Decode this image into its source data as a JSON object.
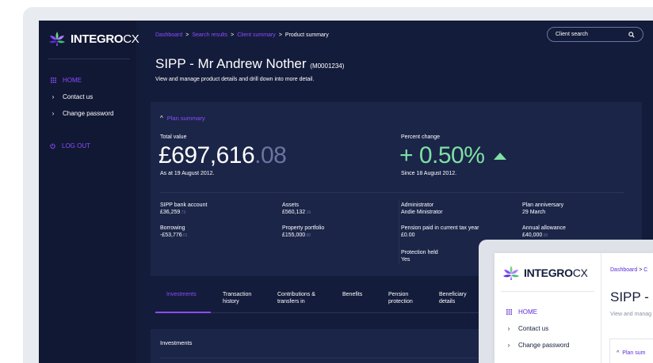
{
  "brand": {
    "name_bold": "INTEGRO",
    "name_light": "CX"
  },
  "sidebar": {
    "items": [
      {
        "label": "HOME",
        "icon": "grid-icon"
      },
      {
        "label": "Contact us",
        "icon": "chevron-right-icon"
      },
      {
        "label": "Change password",
        "icon": "chevron-right-icon"
      }
    ],
    "logout": {
      "label": "LOG OUT",
      "icon": "power-icon"
    }
  },
  "breadcrumb": {
    "items": [
      "Dashboard",
      "Search results",
      "Client summary"
    ],
    "current": "Product summary",
    "separator": ">"
  },
  "search": {
    "placeholder": "Client search",
    "icon": "search-icon"
  },
  "page": {
    "title": "SIPP - Mr Andrew Nother",
    "code": "(M0001234)",
    "subtitle": "View and manage product details and drill down into more detail."
  },
  "plan_summary": {
    "toggle_label": "Plan summary",
    "total_value": {
      "label": "Total value",
      "main": "£697,616",
      "decimal": ".08",
      "note": "As at 19 August 2012."
    },
    "percent_change": {
      "label": "Percent change",
      "value": "+ 0.50%",
      "note": "Since 18 August 2012.",
      "direction": "up"
    },
    "details_left": [
      {
        "label": "SIPP bank account",
        "value": "£36,259",
        "small": ".73"
      },
      {
        "label": "Assets",
        "value": "£560,132",
        "small": ".16"
      },
      {
        "label": "Borrowing",
        "value": "-£53,776",
        "small": ".01"
      },
      {
        "label": "Property portfolio",
        "value": "£155,000",
        "small": ".00"
      }
    ],
    "details_right": [
      {
        "label": "Administrator",
        "value": "Andie Ministrator",
        "small": ""
      },
      {
        "label": "Plan anniversary",
        "value": "29 March",
        "small": ""
      },
      {
        "label": "Pension paid in current tax year",
        "value": "£0.00",
        "small": ""
      },
      {
        "label": "Annual allowance",
        "value": "£40,000",
        "small": ".00"
      },
      {
        "label": "Protection held",
        "value": "Yes",
        "small": ""
      }
    ]
  },
  "tabs": [
    {
      "l1": "",
      "l2": "Investments",
      "active": true
    },
    {
      "l1": "Transaction",
      "l2": "history",
      "active": false
    },
    {
      "l1": "Contributions &",
      "l2": "transfers in",
      "active": false
    },
    {
      "l1": "",
      "l2": "Benefits",
      "active": false
    },
    {
      "l1": "Pension",
      "l2": "protection",
      "active": false
    },
    {
      "l1": "Beneficiary",
      "l2": "details",
      "active": false
    }
  ],
  "investments_section": {
    "title": "Investments"
  },
  "overlay": {
    "breadcrumb_first": "Dashboard",
    "breadcrumb_cut": "C",
    "title": "SIPP - M",
    "subtitle": "View and manag",
    "plan_label": "Plan sum"
  },
  "colors": {
    "bg": "#141c3b",
    "sidebar": "#111834",
    "accent": "#8a4dff",
    "positive": "#7ee0a4"
  }
}
